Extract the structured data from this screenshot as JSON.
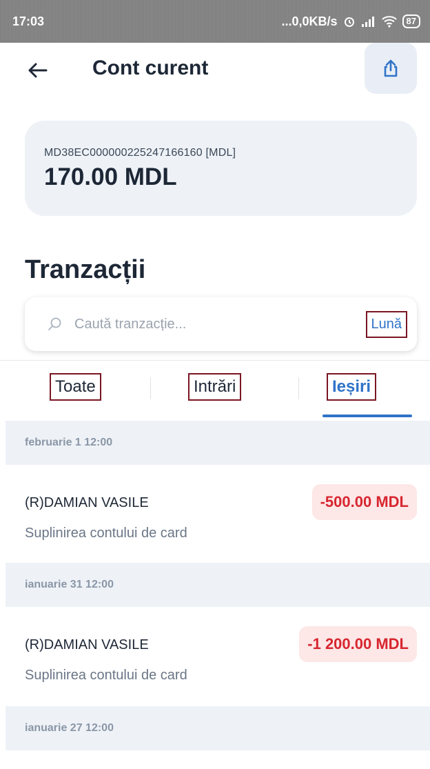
{
  "status_bar": {
    "time": "17:03",
    "network": "...0,0KB/s",
    "battery": "87"
  },
  "header": {
    "title": "Cont curent"
  },
  "account": {
    "iban": "MD38EC000000225247166160 [MDL]",
    "balance": "170.00 MDL"
  },
  "transactions_section": {
    "title": "Tranzacții",
    "search_placeholder": "Caută tranzacție...",
    "period_button": "Lună"
  },
  "tabs": {
    "all": "Toate",
    "incoming": "Intrări",
    "outgoing": "Ieșiri",
    "active": "outgoing"
  },
  "groups": [
    {
      "date": "februarie 1 12:00",
      "transactions": [
        {
          "name": "(R)DAMIAN VASILE",
          "description": "Suplinirea contului de card",
          "amount": "-500.00 MDL"
        }
      ]
    },
    {
      "date": "ianuarie 31 12:00",
      "transactions": [
        {
          "name": "(R)DAMIAN VASILE",
          "description": "Suplinirea contului de card",
          "amount": "-1 200.00 MDL"
        }
      ]
    },
    {
      "date": "ianuarie 27 12:00",
      "transactions": []
    }
  ],
  "colors": {
    "accent": "#2f73c9",
    "negative": "#d7262f",
    "card_bg": "#eef2f7"
  }
}
